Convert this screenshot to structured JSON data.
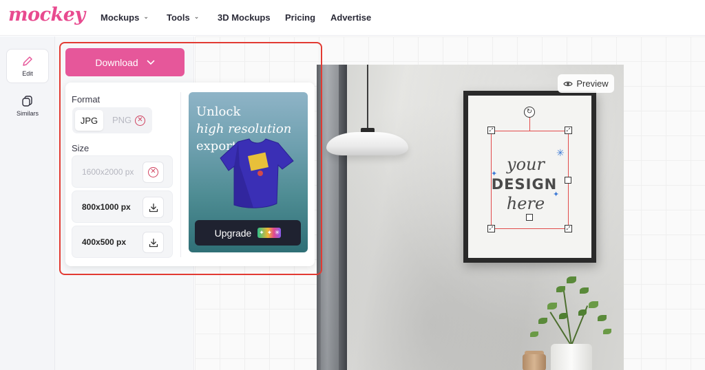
{
  "header": {
    "logo": "mockey",
    "nav": [
      {
        "label": "Mockups",
        "has_dropdown": true
      },
      {
        "label": "Tools",
        "has_dropdown": true
      },
      {
        "label": "3D Mockups",
        "has_dropdown": false
      },
      {
        "label": "Pricing",
        "has_dropdown": false
      },
      {
        "label": "Advertise",
        "has_dropdown": false
      }
    ]
  },
  "rail": {
    "items": [
      {
        "label": "Edit",
        "icon": "pencil-icon",
        "active": true
      },
      {
        "label": "Similars",
        "icon": "stack-icon",
        "active": false
      }
    ]
  },
  "download": {
    "button_label": "Download",
    "format_label": "Format",
    "formats": [
      {
        "label": "JPG",
        "selected": true,
        "locked": false
      },
      {
        "label": "PNG",
        "selected": false,
        "locked": true
      }
    ],
    "size_label": "Size",
    "sizes": [
      {
        "label": "1600x2000 px",
        "locked": true
      },
      {
        "label": "800x1000 px",
        "locked": false
      },
      {
        "label": "400x500 px",
        "locked": false
      }
    ],
    "promo": {
      "line1": "Unlock",
      "line2": "high resolution",
      "line3": "export",
      "upgrade_label": "Upgrade"
    }
  },
  "canvas": {
    "preview_label": "Preview",
    "poster": {
      "word1": "your",
      "word2": "DESIGN",
      "word3": "here"
    }
  },
  "colors": {
    "brand_pink": "#e6579a",
    "highlight_red": "#e23a32",
    "selection_red": "#e24a4a",
    "dark_button": "#1f2230"
  }
}
